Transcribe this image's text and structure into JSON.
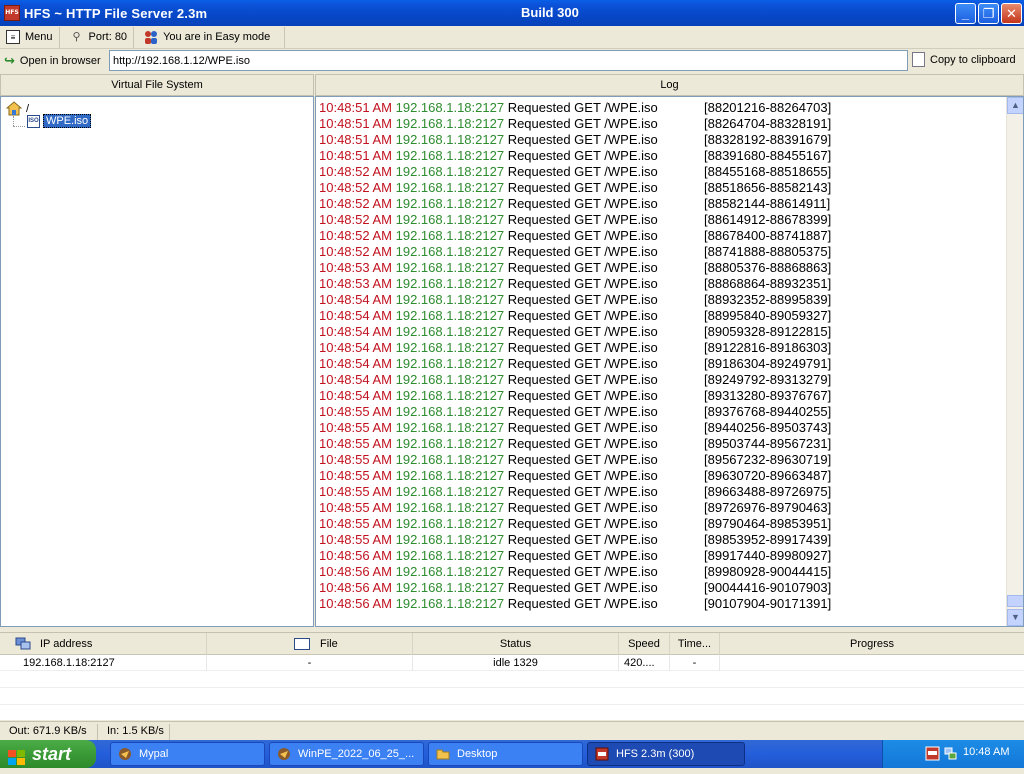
{
  "window": {
    "title": "HFS ~ HTTP File Server 2.3m",
    "build": "Build 300",
    "icon_label": "HFS"
  },
  "toolbar": {
    "menu_label": "Menu",
    "port_label": "Port: 80",
    "mode_label": "You are in Easy mode",
    "open_browser_label": "Open in browser",
    "url_value": "http://192.168.1.12/WPE.iso",
    "copy_label": "Copy to clipboard"
  },
  "vfs": {
    "header": "Virtual File System",
    "root_label": "/",
    "file_label": "WPE.iso",
    "file_icon_text": "ISO"
  },
  "log": {
    "header": "Log",
    "entries": [
      {
        "time": "10:48:51 AM",
        "ip": "192.168.1.18:2127",
        "msg": "Requested GET /WPE.iso",
        "range": "[88201216-88264703]"
      },
      {
        "time": "10:48:51 AM",
        "ip": "192.168.1.18:2127",
        "msg": "Requested GET /WPE.iso",
        "range": "[88264704-88328191]"
      },
      {
        "time": "10:48:51 AM",
        "ip": "192.168.1.18:2127",
        "msg": "Requested GET /WPE.iso",
        "range": "[88328192-88391679]"
      },
      {
        "time": "10:48:51 AM",
        "ip": "192.168.1.18:2127",
        "msg": "Requested GET /WPE.iso",
        "range": "[88391680-88455167]"
      },
      {
        "time": "10:48:52 AM",
        "ip": "192.168.1.18:2127",
        "msg": "Requested GET /WPE.iso",
        "range": "[88455168-88518655]"
      },
      {
        "time": "10:48:52 AM",
        "ip": "192.168.1.18:2127",
        "msg": "Requested GET /WPE.iso",
        "range": "[88518656-88582143]"
      },
      {
        "time": "10:48:52 AM",
        "ip": "192.168.1.18:2127",
        "msg": "Requested GET /WPE.iso",
        "range": "[88582144-88614911]"
      },
      {
        "time": "10:48:52 AM",
        "ip": "192.168.1.18:2127",
        "msg": "Requested GET /WPE.iso",
        "range": "[88614912-88678399]"
      },
      {
        "time": "10:48:52 AM",
        "ip": "192.168.1.18:2127",
        "msg": "Requested GET /WPE.iso",
        "range": "[88678400-88741887]"
      },
      {
        "time": "10:48:52 AM",
        "ip": "192.168.1.18:2127",
        "msg": "Requested GET /WPE.iso",
        "range": "[88741888-88805375]"
      },
      {
        "time": "10:48:53 AM",
        "ip": "192.168.1.18:2127",
        "msg": "Requested GET /WPE.iso",
        "range": "[88805376-88868863]"
      },
      {
        "time": "10:48:53 AM",
        "ip": "192.168.1.18:2127",
        "msg": "Requested GET /WPE.iso",
        "range": "[88868864-88932351]"
      },
      {
        "time": "10:48:54 AM",
        "ip": "192.168.1.18:2127",
        "msg": "Requested GET /WPE.iso",
        "range": "[88932352-88995839]"
      },
      {
        "time": "10:48:54 AM",
        "ip": "192.168.1.18:2127",
        "msg": "Requested GET /WPE.iso",
        "range": "[88995840-89059327]"
      },
      {
        "time": "10:48:54 AM",
        "ip": "192.168.1.18:2127",
        "msg": "Requested GET /WPE.iso",
        "range": "[89059328-89122815]"
      },
      {
        "time": "10:48:54 AM",
        "ip": "192.168.1.18:2127",
        "msg": "Requested GET /WPE.iso",
        "range": "[89122816-89186303]"
      },
      {
        "time": "10:48:54 AM",
        "ip": "192.168.1.18:2127",
        "msg": "Requested GET /WPE.iso",
        "range": "[89186304-89249791]"
      },
      {
        "time": "10:48:54 AM",
        "ip": "192.168.1.18:2127",
        "msg": "Requested GET /WPE.iso",
        "range": "[89249792-89313279]"
      },
      {
        "time": "10:48:54 AM",
        "ip": "192.168.1.18:2127",
        "msg": "Requested GET /WPE.iso",
        "range": "[89313280-89376767]"
      },
      {
        "time": "10:48:55 AM",
        "ip": "192.168.1.18:2127",
        "msg": "Requested GET /WPE.iso",
        "range": "[89376768-89440255]"
      },
      {
        "time": "10:48:55 AM",
        "ip": "192.168.1.18:2127",
        "msg": "Requested GET /WPE.iso",
        "range": "[89440256-89503743]"
      },
      {
        "time": "10:48:55 AM",
        "ip": "192.168.1.18:2127",
        "msg": "Requested GET /WPE.iso",
        "range": "[89503744-89567231]"
      },
      {
        "time": "10:48:55 AM",
        "ip": "192.168.1.18:2127",
        "msg": "Requested GET /WPE.iso",
        "range": "[89567232-89630719]"
      },
      {
        "time": "10:48:55 AM",
        "ip": "192.168.1.18:2127",
        "msg": "Requested GET /WPE.iso",
        "range": "[89630720-89663487]"
      },
      {
        "time": "10:48:55 AM",
        "ip": "192.168.1.18:2127",
        "msg": "Requested GET /WPE.iso",
        "range": "[89663488-89726975]"
      },
      {
        "time": "10:48:55 AM",
        "ip": "192.168.1.18:2127",
        "msg": "Requested GET /WPE.iso",
        "range": "[89726976-89790463]"
      },
      {
        "time": "10:48:55 AM",
        "ip": "192.168.1.18:2127",
        "msg": "Requested GET /WPE.iso",
        "range": "[89790464-89853951]"
      },
      {
        "time": "10:48:55 AM",
        "ip": "192.168.1.18:2127",
        "msg": "Requested GET /WPE.iso",
        "range": "[89853952-89917439]"
      },
      {
        "time": "10:48:56 AM",
        "ip": "192.168.1.18:2127",
        "msg": "Requested GET /WPE.iso",
        "range": "[89917440-89980927]"
      },
      {
        "time": "10:48:56 AM",
        "ip": "192.168.1.18:2127",
        "msg": "Requested GET /WPE.iso",
        "range": "[89980928-90044415]"
      },
      {
        "time": "10:48:56 AM",
        "ip": "192.168.1.18:2127",
        "msg": "Requested GET /WPE.iso",
        "range": "[90044416-90107903]"
      },
      {
        "time": "10:48:56 AM",
        "ip": "192.168.1.18:2127",
        "msg": "Requested GET /WPE.iso",
        "range": "[90107904-90171391]"
      }
    ]
  },
  "connections": {
    "headers": {
      "ip": "IP address",
      "file": "File",
      "status": "Status",
      "speed": "Speed",
      "time": "Time...",
      "progress": "Progress"
    },
    "rows": [
      {
        "ip": "192.168.1.18:2127",
        "file": "-",
        "status": "idle 1329",
        "speed": "420....",
        "time": "-",
        "progress": ""
      }
    ]
  },
  "statusbar": {
    "out": "Out: 671.9 KB/s",
    "in": "In: 1.5 KB/s"
  },
  "taskbar": {
    "start_label": "start",
    "items": [
      {
        "label": "Mypal",
        "active": false
      },
      {
        "label": "WinPE_2022_06_25_...",
        "active": false
      },
      {
        "label": "Desktop",
        "active": false
      },
      {
        "label": "HFS 2.3m (300)",
        "active": true
      }
    ],
    "clock": "10:48 AM"
  },
  "colors": {
    "log_time": "#c1121f",
    "log_ip": "#2e8b2e",
    "titlebar": "#0747c7",
    "start_button": "#3a9a36"
  }
}
